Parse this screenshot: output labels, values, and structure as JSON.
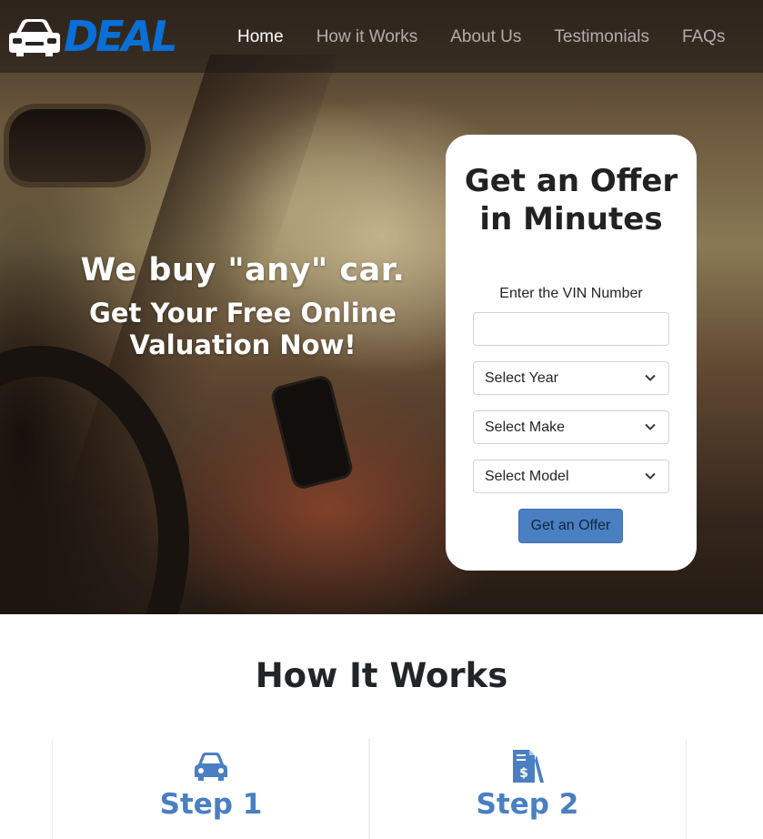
{
  "brand": {
    "name": "DEAL",
    "icon": "car-front-icon",
    "color": "#0a6fd6"
  },
  "nav": {
    "items": [
      {
        "label": "Home",
        "active": true
      },
      {
        "label": "How it Works",
        "active": false
      },
      {
        "label": "About Us",
        "active": false
      },
      {
        "label": "Testimonials",
        "active": false
      },
      {
        "label": "FAQs",
        "active": false
      }
    ]
  },
  "hero": {
    "headline": "We buy \"any\" car.",
    "subheadline": "Get Your Free Online Valuation Now!"
  },
  "form": {
    "title": "Get an Offer in Minutes",
    "vin_label": "Enter the VIN Number",
    "vin_value": "",
    "year_select": "Select Year",
    "make_select": "Select Make",
    "model_select": "Select Model",
    "submit_label": "Get an Offer",
    "accent": "#4a7fc1"
  },
  "how_it_works": {
    "title": "How It Works",
    "steps": [
      {
        "label": "Step 1",
        "icon": "car-icon"
      },
      {
        "label": "Step 2",
        "icon": "invoice-dollar-icon"
      }
    ]
  }
}
